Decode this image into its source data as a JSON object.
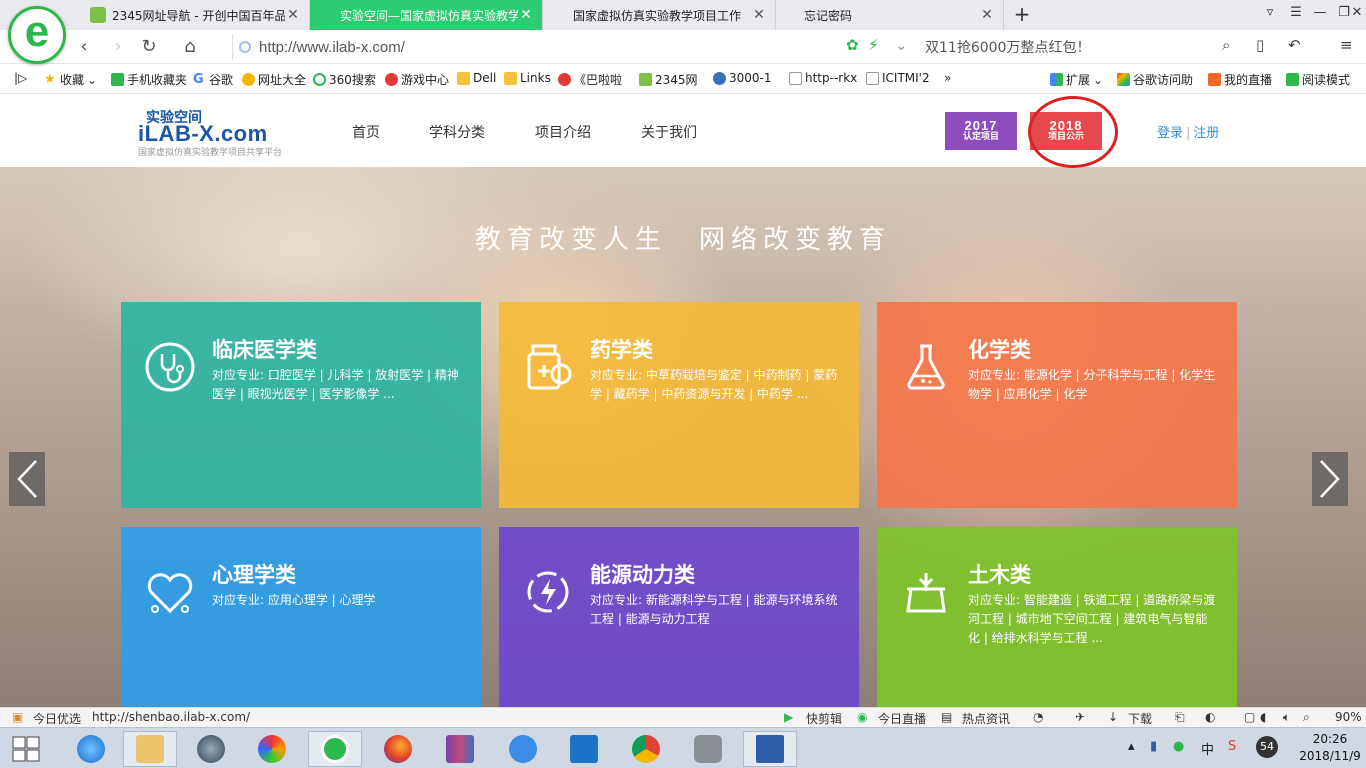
{
  "browser": {
    "tabs": [
      {
        "title": "2345网址导航 - 开创中国百年品牌",
        "active": false
      },
      {
        "title": "实验空间—国家虚拟仿真实验教学",
        "active": true
      },
      {
        "title": "国家虚拟仿真实验教学项目工作",
        "active": false
      },
      {
        "title": "忘记密码",
        "active": false
      }
    ],
    "new_tab": "+",
    "url": "http://www.ilab-x.com/",
    "promo": "双11抢6000万整点红包！",
    "bookmarks": [
      "收藏",
      "手机收藏夹",
      "谷歌",
      "网址大全",
      "360搜索",
      "游戏中心",
      "Dell",
      "Links",
      "《巴啦啦",
      "2345网",
      "3000-1",
      "http--rkx",
      "ICITMI'2",
      "»",
      "扩展",
      "谷歌访问助",
      "我的直播",
      "阅读模式"
    ]
  },
  "site": {
    "logo_cn": "实验空间",
    "logo_en": "iLAB-X.com",
    "logo_sub": "国家虚拟仿真实验教学项目共享平台",
    "nav": [
      "首页",
      "学科分类",
      "项目介绍",
      "关于我们"
    ],
    "btn_2017_year": "2017",
    "btn_2017_label": "认定项目",
    "btn_2018_year": "2018",
    "btn_2018_label": "项目公示",
    "login": "登录",
    "auth_sep": "|",
    "register": "注册",
    "slogan": "教育改变人生　网络改变教育",
    "categories": [
      {
        "title": "临床医学类",
        "desc": "对应专业: 口腔医学 | 儿科学 | 放射医学 | 精神医学 | 眼视光医学 | 医学影像学 ...",
        "color": "#2fb5a0",
        "icon": "stethoscope-icon"
      },
      {
        "title": "药学类",
        "desc": "对应专业: 中草药栽培与鉴定 | 中药制药 | 蒙药学 | 藏药学 | 中药资源与开发 | 中药学 ...",
        "color": "#f6b936",
        "icon": "medicine-icon"
      },
      {
        "title": "化学类",
        "desc": "对应专业: 能源化学 | 分子科学与工程 | 化学生物学 | 应用化学 | 化学",
        "color": "#f4764a",
        "icon": "flask-icon"
      },
      {
        "title": "心理学类",
        "desc": "对应专业: 应用心理学 | 心理学",
        "color": "#2d9ee6",
        "icon": "heart-icon"
      },
      {
        "title": "能源动力类",
        "desc": "对应专业: 新能源科学与工程 | 能源与环境系统工程 | 能源与动力工程",
        "color": "#6b47cf",
        "icon": "energy-icon"
      },
      {
        "title": "土木类",
        "desc": "对应专业: 智能建造 | 铁道工程 | 道路桥梁与渡河工程 | 城市地下空间工程 | 建筑电气与智能化 | 给排水科学与工程 ...",
        "color": "#7ec32a",
        "icon": "building-icon"
      }
    ]
  },
  "status": {
    "today": "今日优选",
    "link": "http://shenbao.ilab-x.com/",
    "items": [
      "快剪辑",
      "今日直播",
      "热点资讯",
      "下载",
      "90%"
    ]
  },
  "taskbar": {
    "time": "20:26",
    "date": "2018/11/9",
    "ime": "中",
    "badge": "54"
  }
}
